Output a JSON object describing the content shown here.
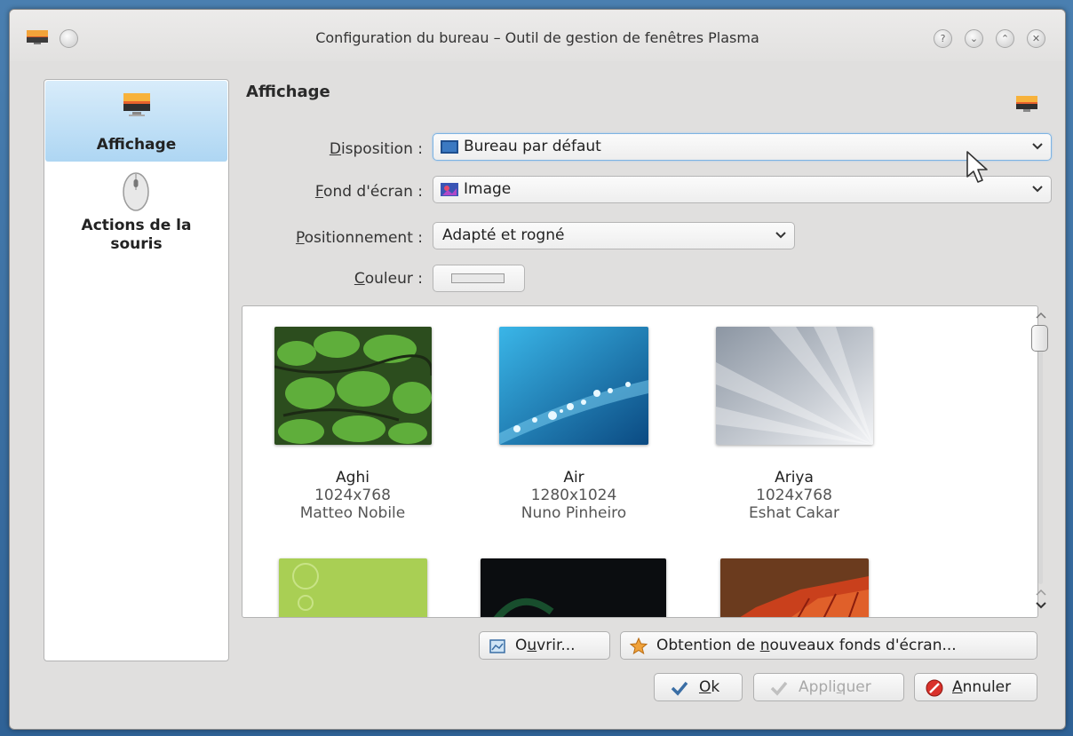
{
  "window": {
    "title": "Configuration du bureau – Outil de gestion de fenêtres Plasma"
  },
  "sidebar": {
    "items": [
      {
        "label": "Affichage",
        "icon": "display-icon",
        "active": true
      },
      {
        "label": "Actions de la souris",
        "icon": "mouse-icon",
        "active": false
      }
    ]
  },
  "main": {
    "title": "Affichage",
    "form": {
      "disposition": {
        "label_key": "D",
        "label_rest": "isposition :",
        "value": "Bureau par défaut"
      },
      "wallpaper": {
        "label_key": "F",
        "label_rest": "ond d'écran :",
        "value": "Image"
      },
      "positioning": {
        "label_key": "P",
        "label_rest": "ositionnement :",
        "value": "Adapté et rogné"
      },
      "color": {
        "label_key": "C",
        "label_rest": "ouleur :"
      }
    },
    "wallpapers": [
      {
        "name": "Aghi",
        "size": "1024x768",
        "author": "Matteo Nobile"
      },
      {
        "name": "Air",
        "size": "1280x1024",
        "author": "Nuno Pinheiro"
      },
      {
        "name": "Ariya",
        "size": "1024x768",
        "author": "Eshat Cakar"
      }
    ]
  },
  "buttons": {
    "open": {
      "pre": "O",
      "key": "u",
      "post": "vrir..."
    },
    "get_new": {
      "pre": "Obtention de ",
      "key": "n",
      "post": "ouveaux fonds d'écran..."
    },
    "ok": {
      "key": "O",
      "post": "k"
    },
    "apply": {
      "pre": "Appli",
      "key": "q",
      "post": "uer"
    },
    "cancel": {
      "key": "A",
      "post": "nnuler"
    }
  },
  "colors": {
    "accent": "#aed6f3",
    "window_bg": "#e0dfde",
    "desktop_bg": "#2f6296"
  }
}
